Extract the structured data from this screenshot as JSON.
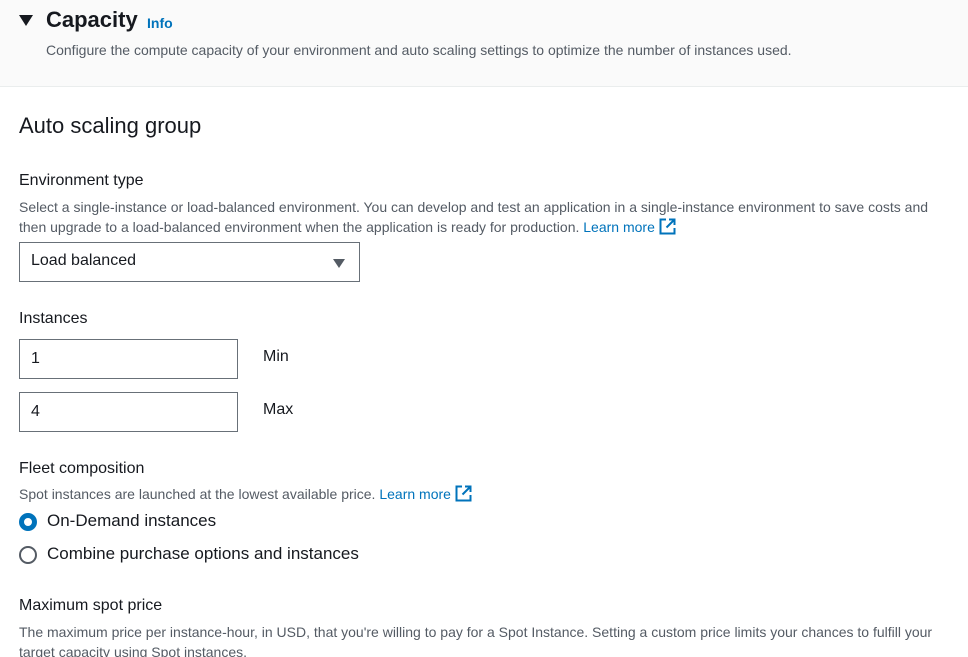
{
  "panel": {
    "title": "Capacity",
    "info_label": "Info",
    "description": "Configure the compute capacity of your environment and auto scaling settings to optimize the number of instances used."
  },
  "section": {
    "title": "Auto scaling group"
  },
  "environment_type": {
    "label": "Environment type",
    "description": "Select a single-instance or load-balanced environment. You can develop and test an application in a single-instance environment to save costs and then upgrade to a load-balanced environment when the application is ready for production.",
    "learn_more": "Learn more",
    "selected": "Load balanced"
  },
  "instances": {
    "label": "Instances",
    "min_value": "1",
    "min_label": "Min",
    "max_value": "4",
    "max_label": "Max"
  },
  "fleet": {
    "label": "Fleet composition",
    "description": "Spot instances are launched at the lowest available price.",
    "learn_more": "Learn more",
    "options": [
      {
        "label": "On-Demand instances",
        "checked": true
      },
      {
        "label": "Combine purchase options and instances",
        "checked": false
      }
    ]
  },
  "max_spot_price": {
    "label": "Maximum spot price",
    "description": "The maximum price per instance-hour, in USD, that you're willing to pay for a Spot Instance. Setting a custom price limits your chances to fulfill your target capacity using Spot instances."
  },
  "colors": {
    "link": "#0073bb",
    "text": "#16191f",
    "secondary_text": "#545b64",
    "header_bg": "#fafafa"
  }
}
